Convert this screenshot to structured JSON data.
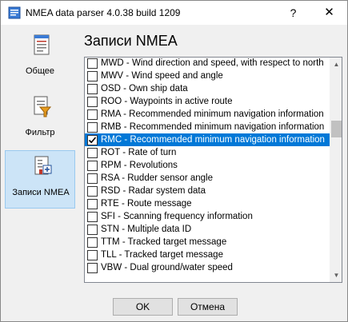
{
  "window": {
    "title": "NMEA data parser 4.0.38 build 1209",
    "help_glyph": "?",
    "close_glyph": "✕"
  },
  "sidebar": {
    "items": [
      {
        "label": "Общее",
        "icon": "document-icon",
        "active": false
      },
      {
        "label": "Фильтр",
        "icon": "filter-icon",
        "active": false
      },
      {
        "label": "Записи NMEA",
        "icon": "records-icon",
        "active": true
      }
    ]
  },
  "main": {
    "heading": "Записи NMEA",
    "list": [
      {
        "label": "MWD - Wind direction and speed, with respect to north",
        "checked": false,
        "selected": false
      },
      {
        "label": "MWV - Wind speed and angle",
        "checked": false,
        "selected": false
      },
      {
        "label": "OSD - Own ship data",
        "checked": false,
        "selected": false
      },
      {
        "label": "ROO - Waypoints in active route",
        "checked": false,
        "selected": false
      },
      {
        "label": "RMA - Recommended minimum navigation information",
        "checked": false,
        "selected": false
      },
      {
        "label": "RMB - Recommended minimum navigation information",
        "checked": false,
        "selected": false
      },
      {
        "label": "RMC - Recommended minimum navigation information",
        "checked": true,
        "selected": true
      },
      {
        "label": "ROT - Rate of turn",
        "checked": false,
        "selected": false
      },
      {
        "label": "RPM - Revolutions",
        "checked": false,
        "selected": false
      },
      {
        "label": "RSA - Rudder sensor angle",
        "checked": false,
        "selected": false
      },
      {
        "label": "RSD - Radar system data",
        "checked": false,
        "selected": false
      },
      {
        "label": "RTE - Route message",
        "checked": false,
        "selected": false
      },
      {
        "label": "SFI - Scanning frequency information",
        "checked": false,
        "selected": false
      },
      {
        "label": "STN - Multiple data ID",
        "checked": false,
        "selected": false
      },
      {
        "label": "TTM - Tracked target message",
        "checked": false,
        "selected": false
      },
      {
        "label": "TLL - Tracked target message",
        "checked": false,
        "selected": false
      },
      {
        "label": "VBW - Dual ground/water speed",
        "checked": false,
        "selected": false
      }
    ]
  },
  "footer": {
    "ok_label": "OK",
    "cancel_label": "Отмена"
  },
  "colors": {
    "selection": "#0078d7",
    "active_side": "#cce4f7"
  }
}
